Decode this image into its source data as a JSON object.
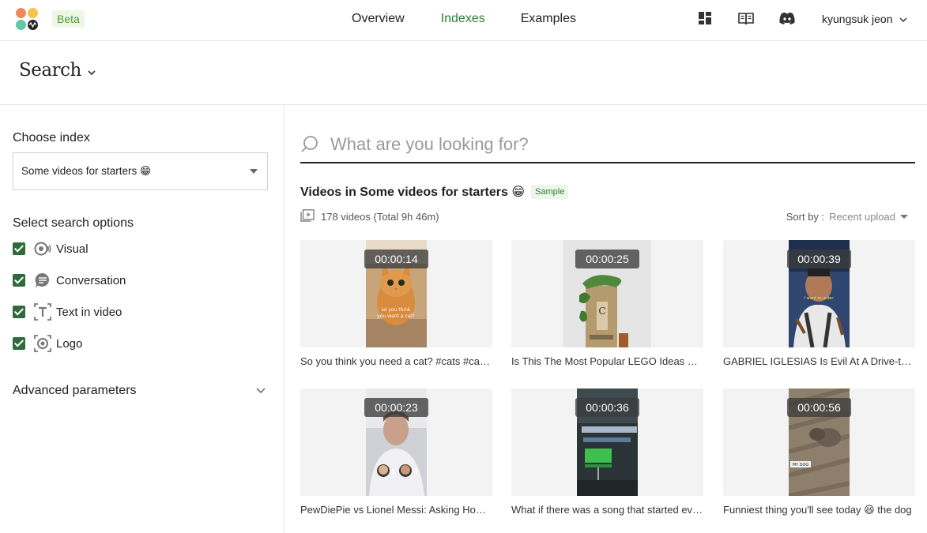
{
  "header": {
    "badge": "Beta",
    "logo_colors": [
      "#f08a5d",
      "#f5c24e",
      "#5fc9a8",
      "#222222"
    ],
    "nav": [
      {
        "label": "Overview",
        "active": false
      },
      {
        "label": "Indexes",
        "active": true
      },
      {
        "label": "Examples",
        "active": false
      }
    ],
    "icons": [
      "dashboard-icon",
      "docs-book-icon",
      "discord-icon"
    ],
    "user_name": "kyungsuk jeon"
  },
  "page": {
    "title": "Search"
  },
  "sidebar": {
    "choose_index_label": "Choose index",
    "index_selected": "Some videos for starters 😁",
    "search_options_label": "Select search options",
    "options": [
      {
        "label": "Visual",
        "checked": true,
        "icon": "visual-icon"
      },
      {
        "label": "Conversation",
        "checked": true,
        "icon": "conversation-icon"
      },
      {
        "label": "Text in video",
        "checked": true,
        "icon": "text-in-video-icon"
      },
      {
        "label": "Logo",
        "checked": true,
        "icon": "logo-icon"
      }
    ],
    "advanced_label": "Advanced parameters"
  },
  "main": {
    "search_placeholder": "What are you looking for?",
    "videos_title": "Videos in Some videos for starters 😁",
    "sample_badge": "Sample",
    "video_count": "178 videos (Total 9h 46m)",
    "sort_label": "Sort by :",
    "sort_value": "Recent upload",
    "videos": [
      {
        "duration": "00:00:14",
        "title": "So you think you need a cat? #cats #cat #catsoftiktok",
        "thumb_color": "#b98a5a"
      },
      {
        "duration": "00:00:25",
        "title": "Is This The Most Popular LEGO Ideas Set Ever?",
        "thumb_color": "#d9d9d9"
      },
      {
        "duration": "00:00:39",
        "title": "GABRIEL IGLESIAS Is Evil At A Drive-thru",
        "thumb_color": "#3a4f7a"
      },
      {
        "duration": "00:00:23",
        "title": "PewDiePie vs Lionel Messi: Asking How Many Goals",
        "thumb_color": "#c7c9cf"
      },
      {
        "duration": "00:00:36",
        "title": "What if there was a song that started every time",
        "thumb_color": "#2e3a3a"
      },
      {
        "duration": "00:00:56",
        "title": "Funniest thing you'll see today 😆 the dog",
        "thumb_color": "#8a7a6a"
      }
    ]
  }
}
